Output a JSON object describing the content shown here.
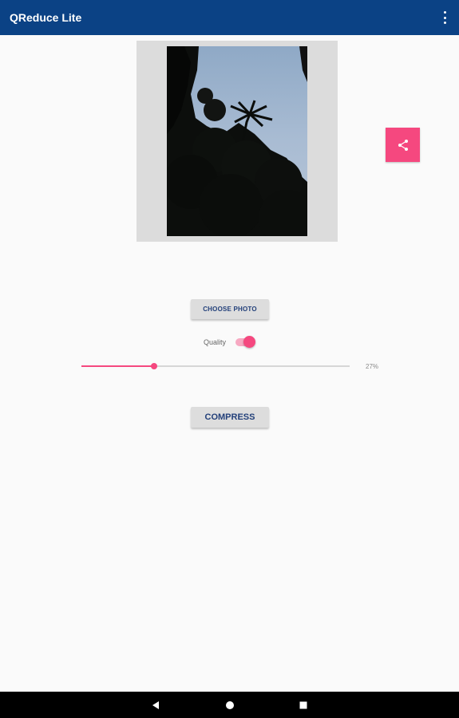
{
  "app": {
    "title": "QReduce Lite"
  },
  "icons": {
    "menu": "more-vert-icon",
    "share": "share-icon",
    "back": "back-icon",
    "home": "home-icon",
    "recents": "recents-icon"
  },
  "preview": {
    "description_icon": "photo-preview"
  },
  "buttons": {
    "choose_photo": "CHOOSE PHOTO",
    "compress": "COMPRESS"
  },
  "quality": {
    "label": "Quality",
    "enabled": true,
    "value_percent": 27,
    "value_text": "27%"
  },
  "colors": {
    "appbar": "#0b4285",
    "accent": "#f5487f",
    "button_text": "#23407a"
  }
}
